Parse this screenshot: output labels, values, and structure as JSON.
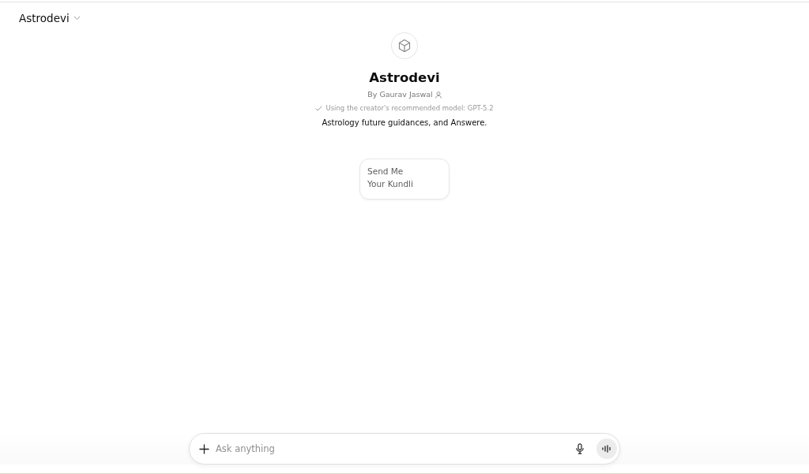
{
  "header": {
    "title": "Astrodevi"
  },
  "gpt": {
    "name": "Astrodevi",
    "author": "By Gaurav Jaswal",
    "model_note": "Using the creator's recommended model: GPT-5.2",
    "description": "Astrology future guidances, and Answere."
  },
  "starters": [
    {
      "text": "Send Me Your Kundli"
    }
  ],
  "composer": {
    "placeholder": "Ask anything"
  }
}
